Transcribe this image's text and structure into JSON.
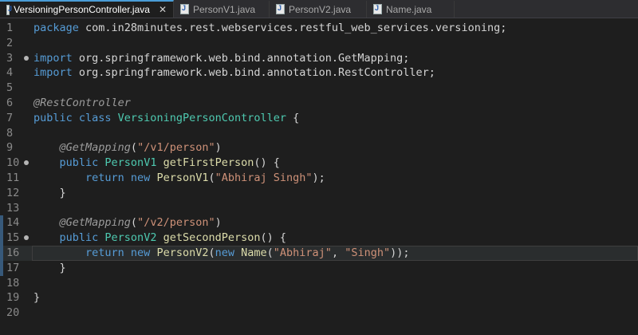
{
  "tabs": [
    {
      "label": "VersioningPersonController.java",
      "active": true,
      "icon": "java-file-icon"
    },
    {
      "label": "PersonV1.java",
      "active": false,
      "icon": "java-file-icon"
    },
    {
      "label": "PersonV2.java",
      "active": false,
      "icon": "java-file-icon"
    },
    {
      "label": "Name.java",
      "active": false,
      "icon": "java-file-icon"
    }
  ],
  "close_glyph": "✕",
  "colors": {
    "keyword": "#569cd6",
    "type": "#4ec9b0",
    "method": "#dcdcaa",
    "string": "#ce9178",
    "annotation": "#9b9b9b",
    "background": "#1e1e1e"
  },
  "current_line": 16,
  "lines": [
    {
      "n": "1",
      "tokens": [
        [
          "kw",
          "package"
        ],
        [
          "ws",
          " com.in28minutes.rest.webservices.restful_web_services.versioning;"
        ]
      ]
    },
    {
      "n": "2",
      "tokens": []
    },
    {
      "n": "3",
      "fold": true,
      "tokens": [
        [
          "kw",
          "import"
        ],
        [
          "ws",
          " org.springframework.web.bind.annotation.GetMapping;"
        ]
      ]
    },
    {
      "n": "4",
      "tokens": [
        [
          "kw",
          "import"
        ],
        [
          "ws",
          " org.springframework.web.bind.annotation.RestController;"
        ]
      ]
    },
    {
      "n": "5",
      "tokens": []
    },
    {
      "n": "6",
      "tokens": [
        [
          "ann",
          "@RestController"
        ]
      ]
    },
    {
      "n": "7",
      "tokens": [
        [
          "kw",
          "public class "
        ],
        [
          "ty",
          "VersioningPersonController"
        ],
        [
          "ws",
          " {"
        ]
      ]
    },
    {
      "n": "8",
      "tokens": []
    },
    {
      "n": "9",
      "tokens": [
        [
          "ws",
          "    "
        ],
        [
          "ann",
          "@GetMapping"
        ],
        [
          "ws",
          "("
        ],
        [
          "str",
          "\"/v1/person\""
        ],
        [
          "ws",
          ")"
        ]
      ]
    },
    {
      "n": "10",
      "fold": true,
      "tokens": [
        [
          "ws",
          "    "
        ],
        [
          "kw",
          "public "
        ],
        [
          "ty",
          "PersonV1"
        ],
        [
          "ws",
          " "
        ],
        [
          "fn",
          "getFirstPerson"
        ],
        [
          "ws",
          "() {"
        ]
      ]
    },
    {
      "n": "11",
      "tokens": [
        [
          "ws",
          "        "
        ],
        [
          "kw",
          "return new "
        ],
        [
          "fn",
          "PersonV1"
        ],
        [
          "ws",
          "("
        ],
        [
          "str",
          "\"Abhiraj Singh\""
        ],
        [
          "ws",
          ");"
        ]
      ]
    },
    {
      "n": "12",
      "tokens": [
        [
          "ws",
          "    }"
        ]
      ]
    },
    {
      "n": "13",
      "tokens": []
    },
    {
      "n": "14",
      "mark": true,
      "tokens": [
        [
          "ws",
          "    "
        ],
        [
          "ann",
          "@GetMapping"
        ],
        [
          "ws",
          "("
        ],
        [
          "str",
          "\"/v2/person\""
        ],
        [
          "ws",
          ")"
        ]
      ]
    },
    {
      "n": "15",
      "mark": true,
      "fold": true,
      "tokens": [
        [
          "ws",
          "    "
        ],
        [
          "kw",
          "public "
        ],
        [
          "ty",
          "PersonV2"
        ],
        [
          "ws",
          " "
        ],
        [
          "fn",
          "getSecondPerson"
        ],
        [
          "ws",
          "() {"
        ]
      ]
    },
    {
      "n": "16",
      "mark": true,
      "tokens": [
        [
          "ws",
          "        "
        ],
        [
          "kw",
          "return new "
        ],
        [
          "fn",
          "PersonV2"
        ],
        [
          "ws",
          "("
        ],
        [
          "kw",
          "new "
        ],
        [
          "fn",
          "Name"
        ],
        [
          "ws",
          "("
        ],
        [
          "str",
          "\"Abhiraj\""
        ],
        [
          "ws",
          ", "
        ],
        [
          "str",
          "\"Singh\""
        ],
        [
          "ws",
          "));"
        ]
      ]
    },
    {
      "n": "17",
      "mark": true,
      "tokens": [
        [
          "ws",
          "    }"
        ]
      ]
    },
    {
      "n": "18",
      "tokens": []
    },
    {
      "n": "19",
      "tokens": [
        [
          "ws",
          "}"
        ]
      ]
    },
    {
      "n": "20",
      "tokens": []
    }
  ]
}
